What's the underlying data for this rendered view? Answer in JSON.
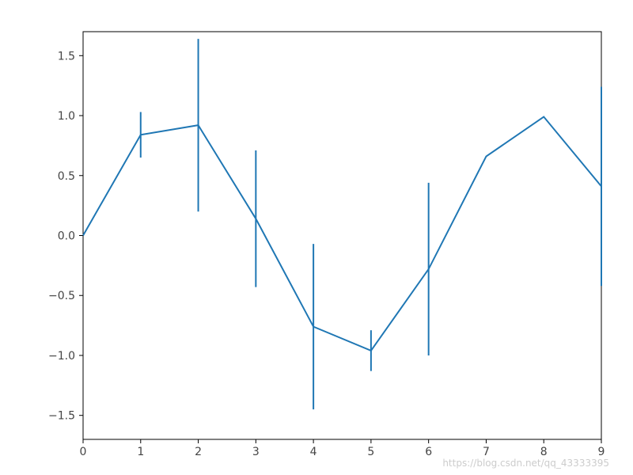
{
  "chart_data": {
    "type": "line",
    "title": "",
    "xlabel": "",
    "ylabel": "",
    "x": [
      0,
      1,
      2,
      3,
      4,
      5,
      6,
      7,
      8,
      9
    ],
    "y": [
      0.0,
      0.84,
      0.92,
      0.14,
      -0.76,
      -0.96,
      -0.28,
      0.66,
      0.99,
      0.41
    ],
    "yerr": [
      0.0,
      0.19,
      0.72,
      0.57,
      0.69,
      0.17,
      0.72,
      0.0,
      0.0,
      0.83
    ],
    "xlim": [
      0,
      9
    ],
    "ylim": [
      -1.7,
      1.7
    ],
    "xticks": [
      0,
      1,
      2,
      3,
      4,
      5,
      6,
      7,
      8,
      9
    ],
    "yticks": [
      -1.5,
      -1.0,
      -0.5,
      0.0,
      0.5,
      1.0,
      1.5
    ],
    "xtick_labels": [
      "0",
      "1",
      "2",
      "3",
      "4",
      "5",
      "6",
      "7",
      "8",
      "9"
    ],
    "ytick_labels": [
      "−1.5",
      "−1.0",
      "−0.5",
      "0.0",
      "0.5",
      "1.0",
      "1.5"
    ],
    "line_color": "#1f77b4"
  },
  "watermark": "https://blog.csdn.net/qq_43333395"
}
